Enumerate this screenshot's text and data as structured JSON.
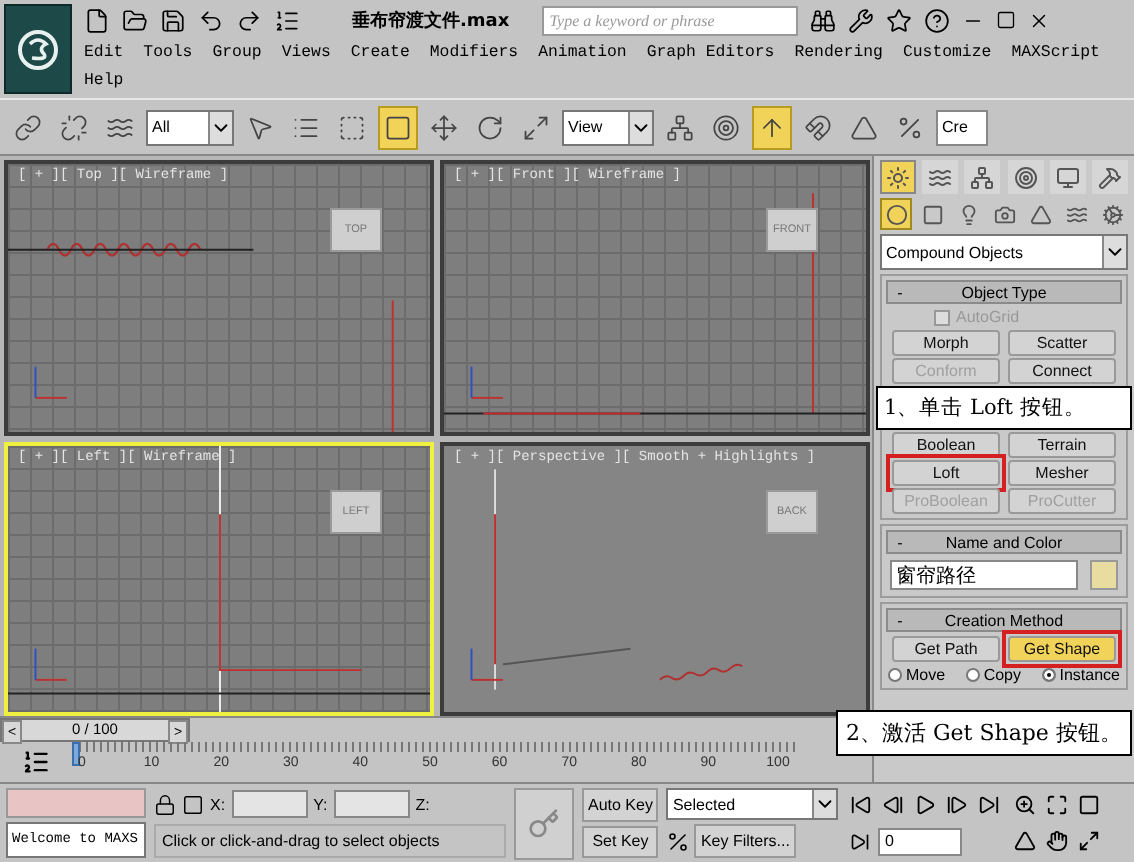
{
  "title_bar": {
    "file_title": "垂布帘渡文件.max",
    "search_placeholder": "Type a keyword or phrase"
  },
  "menu": [
    {
      "label": "Edit"
    },
    {
      "label": "Tools"
    },
    {
      "label": "Group"
    },
    {
      "label": "Views"
    },
    {
      "label": "Create"
    },
    {
      "label": "Modifiers"
    },
    {
      "label": "Animation"
    },
    {
      "label": "Graph Editors"
    },
    {
      "label": "Rendering"
    },
    {
      "label": "Customize"
    },
    {
      "label": "MAXScript"
    },
    {
      "label": "Help"
    }
  ],
  "toolbar": {
    "selection_filter": "All",
    "reference_coord": "View",
    "named_selection": "Cre",
    "window_crossing_on": true,
    "shortcut_override_on": true
  },
  "viewports": [
    {
      "kind": "ortho",
      "label": "[ + ][ Top ][ Wireframe ]",
      "cube_label": "TOP",
      "active": false
    },
    {
      "kind": "ortho",
      "label": "[ + ][ Front ][ Wireframe ]",
      "cube_label": "FRONT",
      "active": false
    },
    {
      "kind": "ortho",
      "label": "[ + ][ Left ][ Wireframe ]",
      "cube_label": "LEFT",
      "active": true
    },
    {
      "kind": "perspective",
      "label": "[ + ][ Perspective ][ Smooth + Highlights ]",
      "cube_label": "BACK",
      "active": false
    }
  ],
  "command_panel": {
    "tabs": [
      {
        "selected": true
      },
      {
        "selected": false
      },
      {
        "selected": false
      },
      {
        "selected": false
      },
      {
        "selected": false
      },
      {
        "selected": false
      }
    ],
    "categories": [
      {
        "selected": true
      },
      {
        "selected": false
      },
      {
        "selected": false
      },
      {
        "selected": false
      },
      {
        "selected": false
      },
      {
        "selected": false
      },
      {
        "selected": false
      }
    ],
    "object_category": "Compound Objects",
    "object_type": {
      "title": "Object Type",
      "collapse_sign": "-",
      "autogrid": {
        "label": "AutoGrid",
        "checked": false,
        "disabled": true
      },
      "items": [
        {
          "kind": "button",
          "label": "Morph",
          "disabled": false,
          "highlighted": false
        },
        {
          "kind": "button",
          "label": "Scatter",
          "disabled": false,
          "highlighted": false
        },
        {
          "kind": "button",
          "label": "Conform",
          "disabled": true,
          "highlighted": false
        },
        {
          "kind": "button",
          "label": "Connect",
          "disabled": false,
          "highlighted": false
        },
        {
          "kind": "callout",
          "label": "1、单击 Loft 按钮。"
        },
        {
          "kind": "button",
          "label": "Boolean",
          "disabled": false,
          "highlighted": false
        },
        {
          "kind": "button",
          "label": "Terrain",
          "disabled": false,
          "highlighted": false
        },
        {
          "kind": "button",
          "label": "Loft",
          "disabled": false,
          "highlighted": true
        },
        {
          "kind": "button",
          "label": "Mesher",
          "disabled": false,
          "highlighted": false
        },
        {
          "kind": "button",
          "label": "ProBoolean",
          "disabled": true,
          "highlighted": false
        },
        {
          "kind": "button",
          "label": "ProCutter",
          "disabled": true,
          "highlighted": false
        }
      ]
    },
    "name_and_color": {
      "title": "Name and Color",
      "collapse_sign": "-",
      "name": "窗帘路径",
      "color": "#e8dca0"
    },
    "creation_method": {
      "title": "Creation Method",
      "collapse_sign": "-",
      "buttons": [
        {
          "label": "Get Path",
          "selected": false,
          "highlighted": false
        },
        {
          "label": "Get Shape",
          "selected": true,
          "highlighted": true
        }
      ],
      "radios": [
        {
          "label": "Move",
          "selected": false
        },
        {
          "label": "Copy",
          "selected": false
        },
        {
          "label": "Instance",
          "selected": true
        }
      ]
    }
  },
  "callout": {
    "text": "2、激活 Get Shape 按钮。"
  },
  "time_slider": {
    "prev": "<",
    "next": ">",
    "position": "0 / 100",
    "level": 0
  },
  "track_bar": {
    "ticks": [
      "0",
      "10",
      "20",
      "30",
      "40",
      "50",
      "60",
      "70",
      "80",
      "90",
      "100"
    ]
  },
  "status_bar": {
    "listener_text": "Welcome to MAXS",
    "x_label": "X:",
    "y_label": "Y:",
    "z_label": "Z:",
    "prompt": "Click or click-and-drag to select objects",
    "auto_key": {
      "label": "Auto Key",
      "on": false
    },
    "set_key": "Set Key",
    "key_mode": "Selected",
    "key_filters": "Key Filters...",
    "frame": "0"
  }
}
